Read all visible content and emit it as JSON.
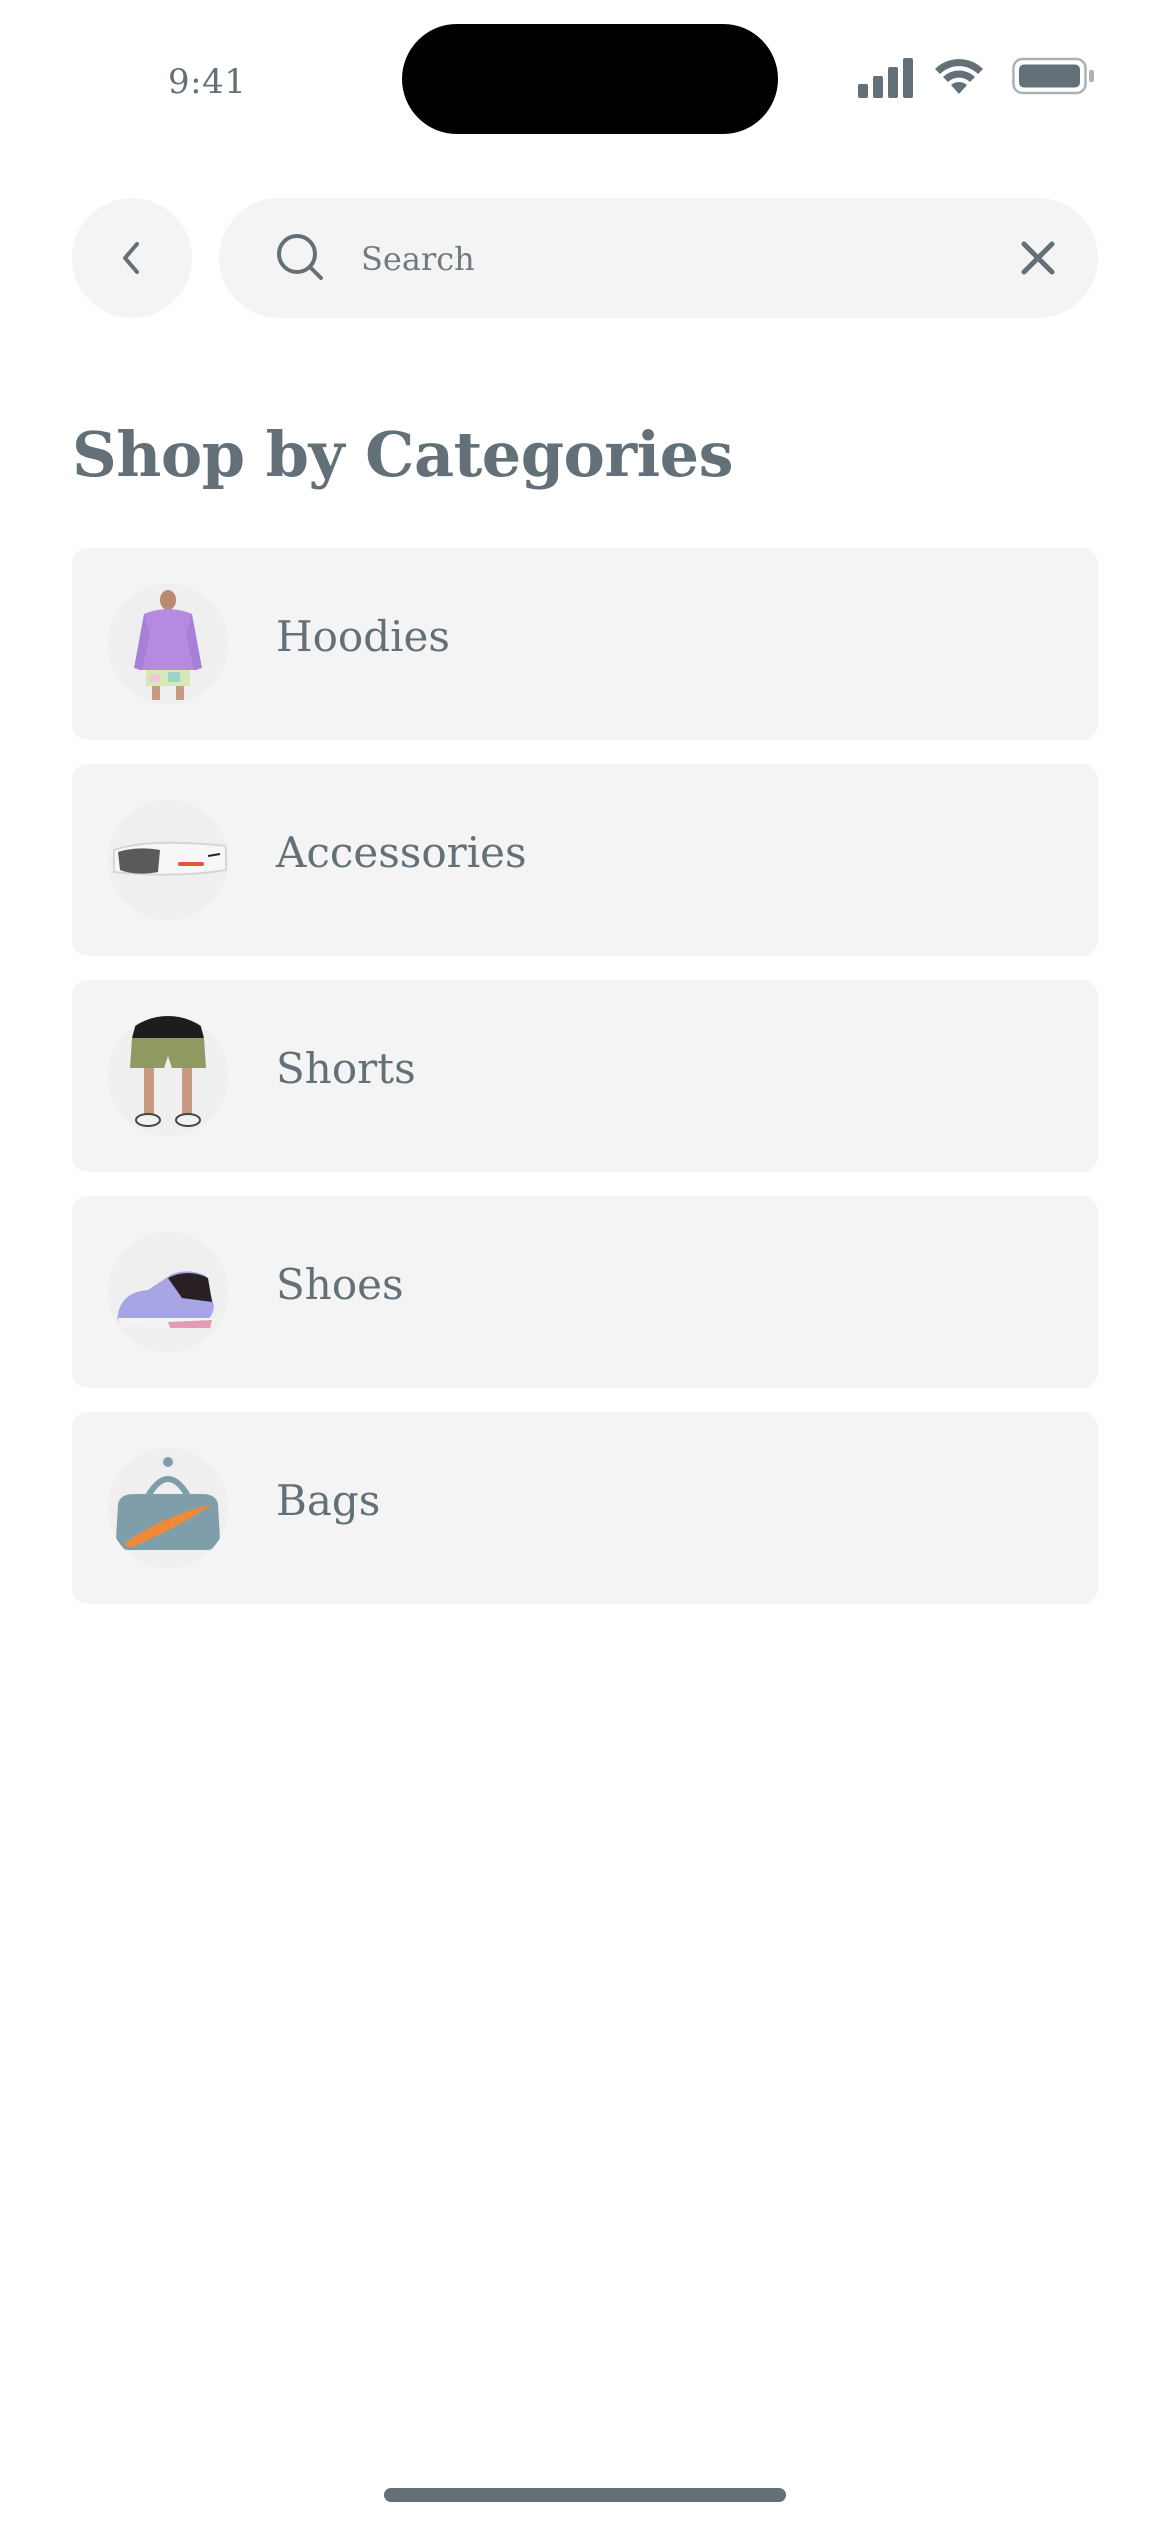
{
  "status_bar": {
    "time": "9:41",
    "icons": [
      "cellular-signal-icon",
      "wifi-icon",
      "battery-icon"
    ]
  },
  "search": {
    "placeholder": "Search",
    "value": "",
    "icons": [
      "chevron-left-icon",
      "search-icon",
      "close-icon"
    ]
  },
  "section": {
    "title": "Shop by Categories"
  },
  "categories": [
    {
      "label": "Hoodies",
      "image": "purple-hoodie-image"
    },
    {
      "label": "Accessories",
      "image": "sunglasses-image"
    },
    {
      "label": "Shorts",
      "image": "shorts-image"
    },
    {
      "label": "Shoes",
      "image": "sneaker-image"
    },
    {
      "label": "Bags",
      "image": "duffel-bag-image"
    }
  ],
  "colors": {
    "text": "#637077",
    "card_background": "#f4f4f4",
    "background": "#ffffff"
  }
}
